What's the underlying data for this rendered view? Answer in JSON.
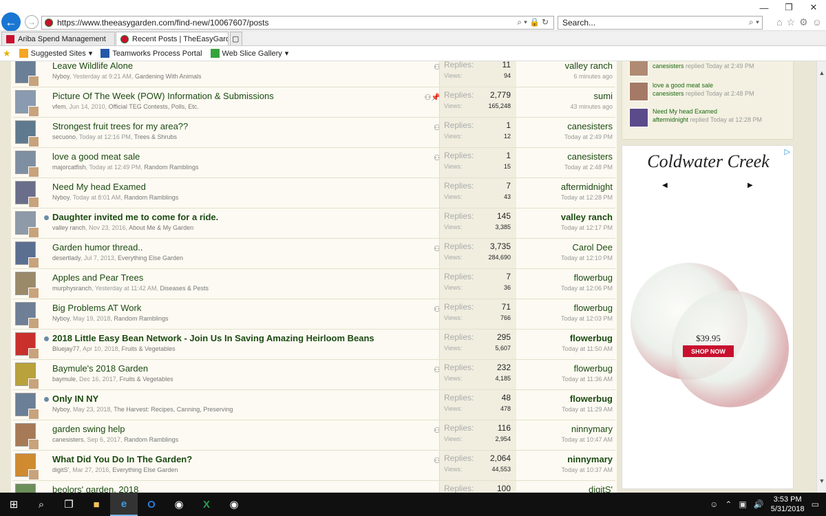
{
  "browser": {
    "url": "https://www.theeasygarden.com/find-new/10067607/posts",
    "search_placeholder": "Search...",
    "tabs": [
      {
        "label": "Ariba Spend Management"
      },
      {
        "label": "Recent Posts | TheEasyGard..."
      }
    ],
    "favorites": [
      "Suggested Sites",
      "Teamworks Process Portal",
      "Web Slice Gallery"
    ]
  },
  "threads": [
    {
      "title": "Leave Wildlife Alone",
      "bold": false,
      "dot": false,
      "author": "Nyboy",
      "date": "Yesterday at 9:21 AM",
      "forum": "Gardening With Animals",
      "icons": "⚇",
      "replies": "11",
      "views": "94",
      "last_user": "valley ranch",
      "last_time": "6 minutes ago"
    },
    {
      "title": "Picture Of The Week (POW) Information & Submissions",
      "bold": false,
      "dot": false,
      "author": "vfem",
      "date": "Jun 14, 2010",
      "forum": "Official TEG Contests, Polls, Etc.",
      "icons": "⚇📌",
      "replies": "2,779",
      "views": "165,248",
      "last_user": "sumi",
      "last_time": "43 minutes ago"
    },
    {
      "title": "Strongest fruit trees for my area??",
      "bold": false,
      "dot": false,
      "author": "secuono",
      "date": "Today at 12:16 PM",
      "forum": "Trees & Shrubs",
      "icons": "⚇",
      "replies": "1",
      "views": "12",
      "last_user": "canesisters",
      "last_time": "Today at 2:49 PM"
    },
    {
      "title": "love a good meat sale",
      "bold": false,
      "dot": false,
      "author": "majorcatfish",
      "date": "Today at 12:49 PM",
      "forum": "Random Ramblings",
      "icons": "⚇",
      "replies": "1",
      "views": "15",
      "last_user": "canesisters",
      "last_time": "Today at 2:48 PM"
    },
    {
      "title": "Need My head Examed",
      "bold": false,
      "dot": false,
      "author": "Nyboy",
      "date": "Today at 8:01 AM",
      "forum": "Random Ramblings",
      "icons": "",
      "replies": "7",
      "views": "43",
      "last_user": "aftermidnight",
      "last_time": "Today at 12:28 PM"
    },
    {
      "title": "Daughter invited me to come for a ride.",
      "bold": true,
      "dot": true,
      "author": "valley ranch",
      "date": "Nov 23, 2016",
      "forum": "About Me & My Garden",
      "icons": "",
      "replies": "145",
      "views": "3,385",
      "last_user": "valley ranch",
      "last_time": "Today at 12:17 PM"
    },
    {
      "title": "Garden humor thread..",
      "bold": false,
      "dot": false,
      "author": "desertlady",
      "date": "Jul 7, 2013",
      "forum": "Everything Else Garden",
      "icons": "⚇",
      "replies": "3,735",
      "views": "284,690",
      "last_user": "Carol Dee",
      "last_time": "Today at 12:10 PM"
    },
    {
      "title": "Apples and Pear Trees",
      "bold": false,
      "dot": false,
      "author": "murphysranch",
      "date": "Yesterday at 11:42 AM",
      "forum": "Diseases & Pests",
      "icons": "",
      "replies": "7",
      "views": "36",
      "last_user": "flowerbug",
      "last_time": "Today at 12:06 PM"
    },
    {
      "title": "Big Problems AT Work",
      "bold": false,
      "dot": false,
      "author": "Nyboy",
      "date": "May 19, 2018",
      "forum": "Random Ramblings",
      "icons": "⚇",
      "replies": "71",
      "views": "766",
      "last_user": "flowerbug",
      "last_time": "Today at 12:03 PM"
    },
    {
      "title": "2018 Little Easy Bean Network - Join Us In Saving Amazing Heirloom Beans",
      "bold": true,
      "dot": true,
      "author": "Bluejay77",
      "date": "Apr 10, 2018",
      "forum": "Fruits & Vegetables",
      "icons": "",
      "replies": "295",
      "views": "5,607",
      "last_user": "flowerbug",
      "last_time": "Today at 11:50 AM"
    },
    {
      "title": "Baymule's 2018 Garden",
      "bold": false,
      "dot": false,
      "author": "baymule",
      "date": "Dec 16, 2017",
      "forum": "Fruits & Vegetables",
      "icons": "⚇",
      "replies": "232",
      "views": "4,185",
      "last_user": "flowerbug",
      "last_time": "Today at 11:36 AM"
    },
    {
      "title": "Only IN NY",
      "bold": true,
      "dot": true,
      "author": "Nyboy",
      "date": "May 23, 2018",
      "forum": "The Harvest: Recipes, Canning, Preserving",
      "icons": "",
      "replies": "48",
      "views": "478",
      "last_user": "flowerbug",
      "last_time": "Today at 11:29 AM"
    },
    {
      "title": "garden swing help",
      "bold": false,
      "dot": false,
      "author": "canesisters",
      "date": "Sep 6, 2017",
      "forum": "Random Ramblings",
      "icons": "⚇",
      "replies": "116",
      "views": "2,954",
      "last_user": "ninnymary",
      "last_time": "Today at 10:47 AM"
    },
    {
      "title": "What Did You Do In The Garden?",
      "bold": true,
      "dot": false,
      "author": "digitS'",
      "date": "Mar 27, 2016",
      "forum": "Everything Else Garden",
      "icons": "⚇",
      "replies": "2,064",
      "views": "44,553",
      "last_user": "ninnymary",
      "last_time": "Today at 10:37 AM"
    },
    {
      "title": "beolors' garden, 2018",
      "bold": false,
      "dot": false,
      "author": "",
      "date": "",
      "forum": "",
      "icons": "",
      "replies": "100",
      "views": "",
      "last_user": "digitS'",
      "last_time": ""
    }
  ],
  "labels": {
    "replies": "Replies:",
    "views": "Views:"
  },
  "recent_activity": [
    {
      "title": "",
      "user": "canesisters",
      "action": "replied Today at 2:49 PM"
    },
    {
      "title": "love a good meat sale",
      "user": "canesisters",
      "action": "replied Today at 2:48 PM"
    },
    {
      "title": "Need My head Examed",
      "user": "aftermidnight",
      "action": "replied Today at 12:28 PM"
    }
  ],
  "ad": {
    "brand": "Coldwater Creek",
    "price": "$39.95",
    "cta": "SHOP NOW"
  },
  "taskbar": {
    "time": "3:53 PM",
    "date": "5/31/2018"
  },
  "colors": {
    "link_green": "#1c4a13",
    "ad_red": "#c8102e",
    "ie_blue": "#1976d2"
  }
}
